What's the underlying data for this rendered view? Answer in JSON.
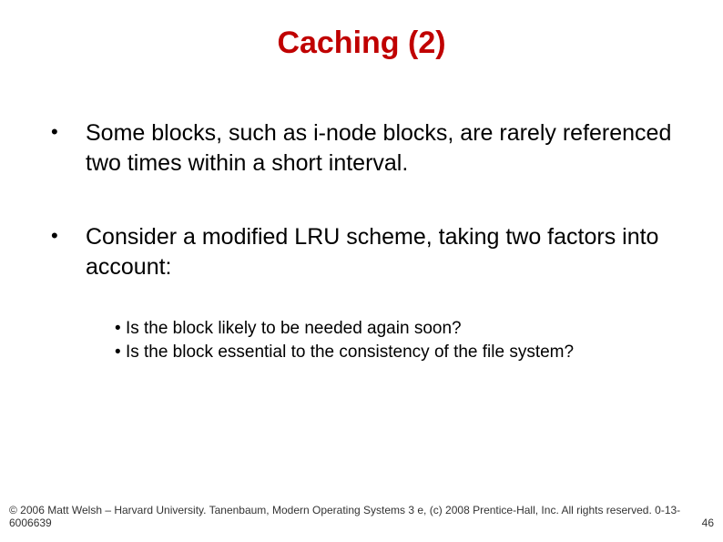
{
  "title": "Caching (2)",
  "bullets": [
    "Some blocks, such as i-node blocks, are rarely referenced two times within a short interval.",
    "Consider a modified LRU scheme, taking two factors into account:"
  ],
  "sub_bullets": [
    "Is the block likely to be needed again soon?",
    "Is the block essential to the consistency of the file system?"
  ],
  "footer": {
    "credits": "© 2006 Matt Welsh – Harvard University. Tanenbaum, Modern Operating Systems 3 e, (c) 2008 Prentice-Hall, Inc. All rights reserved. 0-13-6006639",
    "slide_number": "46"
  }
}
